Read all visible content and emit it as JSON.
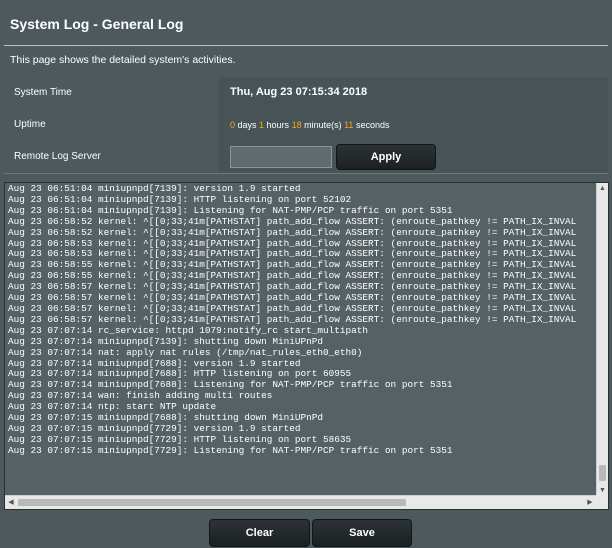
{
  "header": {
    "title": "System Log - General Log",
    "description": "This page shows the detailed system's activities."
  },
  "system_time": {
    "label": "System Time",
    "value": "Thu, Aug 23 07:15:34 2018"
  },
  "uptime": {
    "label": "Uptime",
    "days": "0",
    "days_unit": " days ",
    "hours": "1",
    "hours_unit": " hours ",
    "minutes": "18",
    "minutes_unit": " minute(s) ",
    "seconds": "11",
    "seconds_unit": " seconds"
  },
  "remote_log": {
    "label": "Remote Log Server",
    "value": "",
    "apply_label": "Apply"
  },
  "log": {
    "lines": [
      "Aug 23 06:51:04 miniupnpd[7139]: version 1.9 started",
      "Aug 23 06:51:04 miniupnpd[7139]: HTTP listening on port 52102",
      "Aug 23 06:51:04 miniupnpd[7139]: Listening for NAT-PMP/PCP traffic on port 5351",
      "Aug 23 06:58:52 kernel: ^[[0;33;41m[PATHSTAT] path_add_flow ASSERT: (enroute_pathkey != PATH_IX_INVAL",
      "Aug 23 06:58:52 kernel: ^[[0;33;41m[PATHSTAT] path_add_flow ASSERT: (enroute_pathkey != PATH_IX_INVAL",
      "Aug 23 06:58:53 kernel: ^[[0;33;41m[PATHSTAT] path_add_flow ASSERT: (enroute_pathkey != PATH_IX_INVAL",
      "Aug 23 06:58:53 kernel: ^[[0;33;41m[PATHSTAT] path_add_flow ASSERT: (enroute_pathkey != PATH_IX_INVAL",
      "Aug 23 06:58:55 kernel: ^[[0;33;41m[PATHSTAT] path_add_flow ASSERT: (enroute_pathkey != PATH_IX_INVAL",
      "Aug 23 06:58:55 kernel: ^[[0;33;41m[PATHSTAT] path_add_flow ASSERT: (enroute_pathkey != PATH_IX_INVAL",
      "Aug 23 06:58:57 kernel: ^[[0;33;41m[PATHSTAT] path_add_flow ASSERT: (enroute_pathkey != PATH_IX_INVAL",
      "Aug 23 06:58:57 kernel: ^[[0;33;41m[PATHSTAT] path_add_flow ASSERT: (enroute_pathkey != PATH_IX_INVAL",
      "Aug 23 06:58:57 kernel: ^[[0;33;41m[PATHSTAT] path_add_flow ASSERT: (enroute_pathkey != PATH_IX_INVAL",
      "Aug 23 06:58:57 kernel: ^[[0;33;41m[PATHSTAT] path_add_flow ASSERT: (enroute_pathkey != PATH_IX_INVAL",
      "Aug 23 07:07:14 rc_service: httpd 1079:notify_rc start_multipath",
      "Aug 23 07:07:14 miniupnpd[7139]: shutting down MiniUPnPd",
      "Aug 23 07:07:14 nat: apply nat rules (/tmp/nat_rules_eth0_eth0)",
      "Aug 23 07:07:14 miniupnpd[7688]: version 1.9 started",
      "Aug 23 07:07:14 miniupnpd[7688]: HTTP listening on port 60955",
      "Aug 23 07:07:14 miniupnpd[7688]: Listening for NAT-PMP/PCP traffic on port 5351",
      "Aug 23 07:07:14 wan: finish adding multi routes",
      "Aug 23 07:07:14 ntp: start NTP update",
      "Aug 23 07:07:15 miniupnpd[7688]: shutting down MiniUPnPd",
      "Aug 23 07:07:15 miniupnpd[7729]: version 1.9 started",
      "Aug 23 07:07:15 miniupnpd[7729]: HTTP listening on port 58635",
      "Aug 23 07:07:15 miniupnpd[7729]: Listening for NAT-PMP/PCP traffic on port 5351"
    ]
  },
  "actions": {
    "clear_label": "Clear",
    "save_label": "Save"
  },
  "icons": {
    "scroll_up": "chevron-up-icon",
    "scroll_down": "chevron-down-icon",
    "scroll_left": "chevron-left-icon",
    "scroll_right": "chevron-right-icon"
  },
  "colors": {
    "background": "#4d595d",
    "highlight_number": "#f5a623",
    "button": "#1b2022"
  }
}
